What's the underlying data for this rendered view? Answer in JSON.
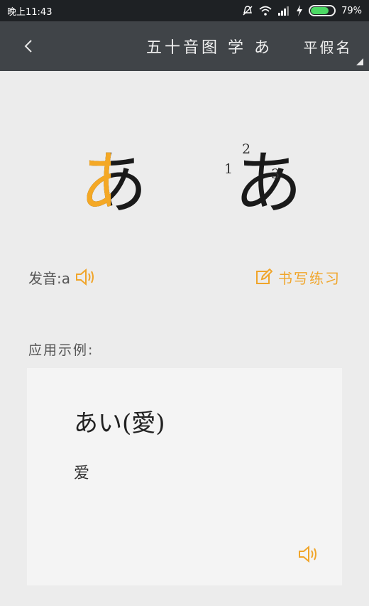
{
  "status_bar": {
    "time": "晚上11:43",
    "battery": "79%",
    "battery_level": 0.79
  },
  "header": {
    "back_icon": "chevron-left-icon",
    "title": "五十音图 学 あ",
    "mode": "平假名"
  },
  "kana": {
    "character": "あ",
    "stroke_numbers": [
      "1",
      "2",
      "3"
    ]
  },
  "pronunciation": {
    "label": "发音:a",
    "icon": "speaker-icon"
  },
  "practice": {
    "label": "书写练习",
    "icon": "edit-icon"
  },
  "examples": {
    "label": "应用示例:",
    "items": [
      {
        "word": "あい(愛)",
        "meaning": "爱"
      }
    ]
  },
  "colors": {
    "accent": "#f0a52a",
    "header_bg": "#404448",
    "status_bg": "#1e2124",
    "page_bg": "#ececec"
  }
}
